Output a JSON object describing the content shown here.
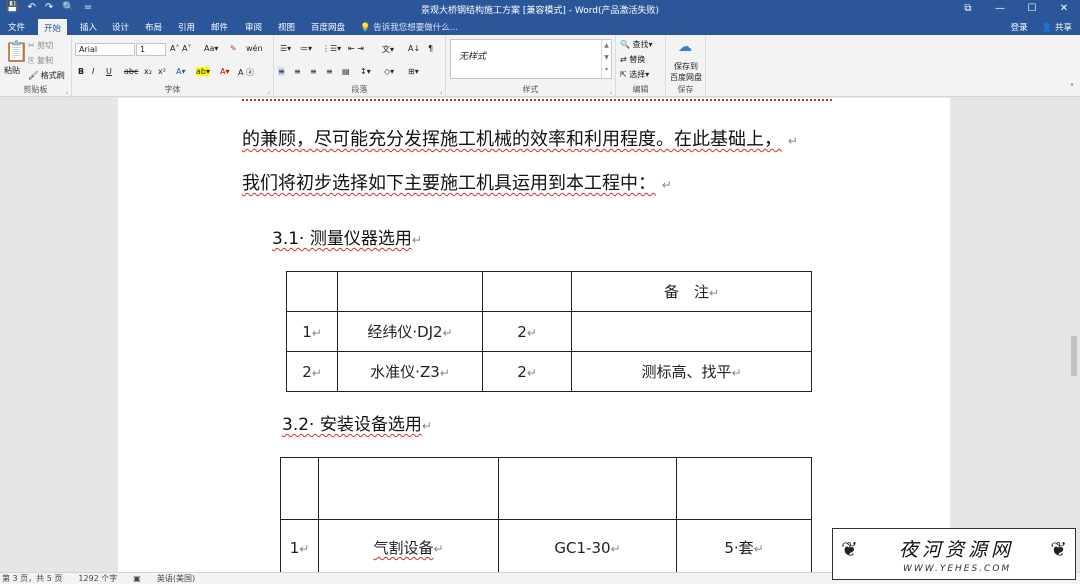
{
  "window": {
    "title": "景观大桥钢结构施工方案 [兼容模式] - Word(产品激活失败)",
    "quick_access": [
      "💾",
      "↶",
      "↷",
      "🔍",
      "="
    ],
    "controls": [
      "⧉",
      "—",
      "☐",
      "✕"
    ]
  },
  "tabs": [
    "文件",
    "开始",
    "插入",
    "设计",
    "布局",
    "引用",
    "邮件",
    "审阅",
    "视图",
    "百度网盘"
  ],
  "active_tab": "开始",
  "tell_me": "告诉我您想要做什么...",
  "account": {
    "login": "登录",
    "share": "共享"
  },
  "ribbon": {
    "clipboard": {
      "label": "剪贴板",
      "paste": "粘贴",
      "cut": "剪切",
      "copy": "复制",
      "format_painter": "格式刷"
    },
    "font": {
      "label": "字体",
      "font_name": "Arial",
      "font_size": "1",
      "bold": "B",
      "italic": "I",
      "underline": "U",
      "strike": "abc",
      "sub": "x₂",
      "sup": "x²"
    },
    "paragraph": {
      "label": "段落"
    },
    "styles": {
      "label": "样式",
      "current": "无样式"
    },
    "editing": {
      "label": "编辑",
      "find": "查找",
      "replace": "替换",
      "select": "选择"
    },
    "save": {
      "label": "保存",
      "button": "保存到\n百度网盘",
      "line1": "保存到",
      "line2": "百度网盘"
    }
  },
  "document": {
    "para1": "的兼顾，尽可能充分发挥施工机械的效率和利用程度。在此基础上，",
    "para2": "我们将初步选择如下主要施工机具运用到本工程中：",
    "heading1": "3.1· 测量仪器选用",
    "table1": {
      "header": [
        "",
        "",
        "",
        "备　注"
      ],
      "rows": [
        [
          "1",
          "经纬仪·DJ2",
          "2",
          ""
        ],
        [
          "2",
          "水准仪·Z3",
          "2",
          "测标高、找平"
        ]
      ]
    },
    "heading2": "3.2· 安装设备选用",
    "table2": {
      "header": [
        "",
        "",
        "",
        ""
      ],
      "rows": [
        [
          "1",
          "气割设备",
          "GC1-30",
          "5·套"
        ]
      ]
    },
    "para_mark": "↵"
  },
  "status": {
    "page": "第 3 页，共 5 页",
    "words": "1292 个字",
    "language": "英语(美国)"
  },
  "watermark": {
    "text": "夜河资源网",
    "url": "WWW.YEHES.COM"
  }
}
